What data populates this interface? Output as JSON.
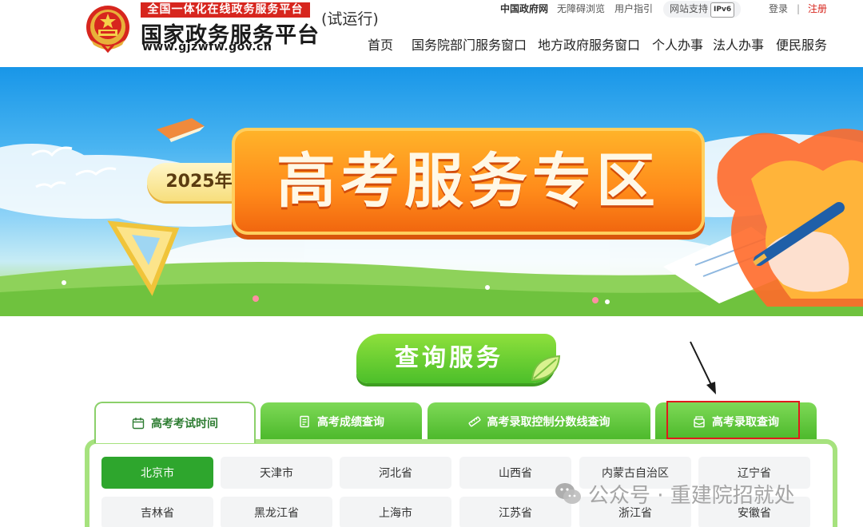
{
  "header": {
    "logo_banner": "全国一体化在线政务服务平台",
    "logo_title": "国家政务服务平台",
    "logo_url": "www.gjzwfw.gov.cn",
    "trial": "(试运行)",
    "toplinks": {
      "gov": "中国政府网",
      "accessible": "无障碍浏览",
      "guide": "用户指引",
      "support": "网站支持",
      "ipv6": "IPv6",
      "login": "登录",
      "separator": "|",
      "register": "注册"
    },
    "nav": [
      "首页",
      "国务院部门服务窗口",
      "地方政府服务窗口",
      "个人办事",
      "法人办事",
      "便民服务"
    ]
  },
  "banner": {
    "year": "2025年",
    "title": "高考服务专区"
  },
  "section": {
    "title": "查询服务"
  },
  "tabs": [
    {
      "label": "高考考试时间",
      "icon": "calendar-icon",
      "active": true
    },
    {
      "label": "高考成绩查询",
      "icon": "document-icon",
      "active": false
    },
    {
      "label": "高考录取控制分数线查询",
      "icon": "ruler-icon",
      "active": false
    },
    {
      "label": "高考录取查询",
      "icon": "envelope-icon",
      "active": false
    }
  ],
  "provinces": {
    "row1": [
      "北京市",
      "天津市",
      "河北省",
      "山西省",
      "内蒙古自治区",
      "辽宁省"
    ],
    "row2": [
      "吉林省",
      "黑龙江省",
      "上海市",
      "江苏省",
      "浙江省",
      "安徽省"
    ],
    "active": "北京市"
  },
  "watermark": {
    "text": "公众号 · 重建院招就处"
  },
  "colors": {
    "brand_red": "#d7261e",
    "tab_green": "#4bb82a",
    "active_province": "#2ea62d",
    "highlight_red": "#e0191c"
  }
}
